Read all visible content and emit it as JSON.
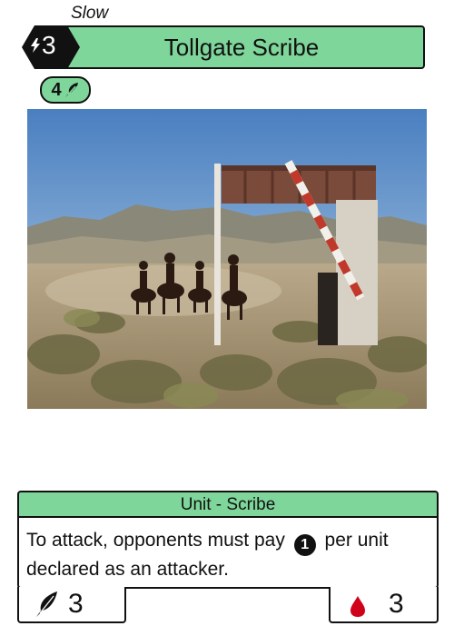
{
  "card": {
    "speed": "Slow",
    "cost": "3",
    "title": "Tollgate Scribe",
    "pill_value": "4",
    "type_line": "Unit - Scribe",
    "rules_text_before": "To attack, opponents must pay",
    "rules_mana_symbol": "1",
    "rules_text_after": "per unit declared as an attacker.",
    "power": "3",
    "health": "3"
  },
  "colors": {
    "accent_green": "#7fd69a",
    "health_red": "#d0021b",
    "ink": "#111111"
  },
  "icons": {
    "cost": "lightning-hexagon-icon",
    "pill": "feather-icon",
    "power": "quill-icon",
    "health": "blood-drop-icon"
  }
}
